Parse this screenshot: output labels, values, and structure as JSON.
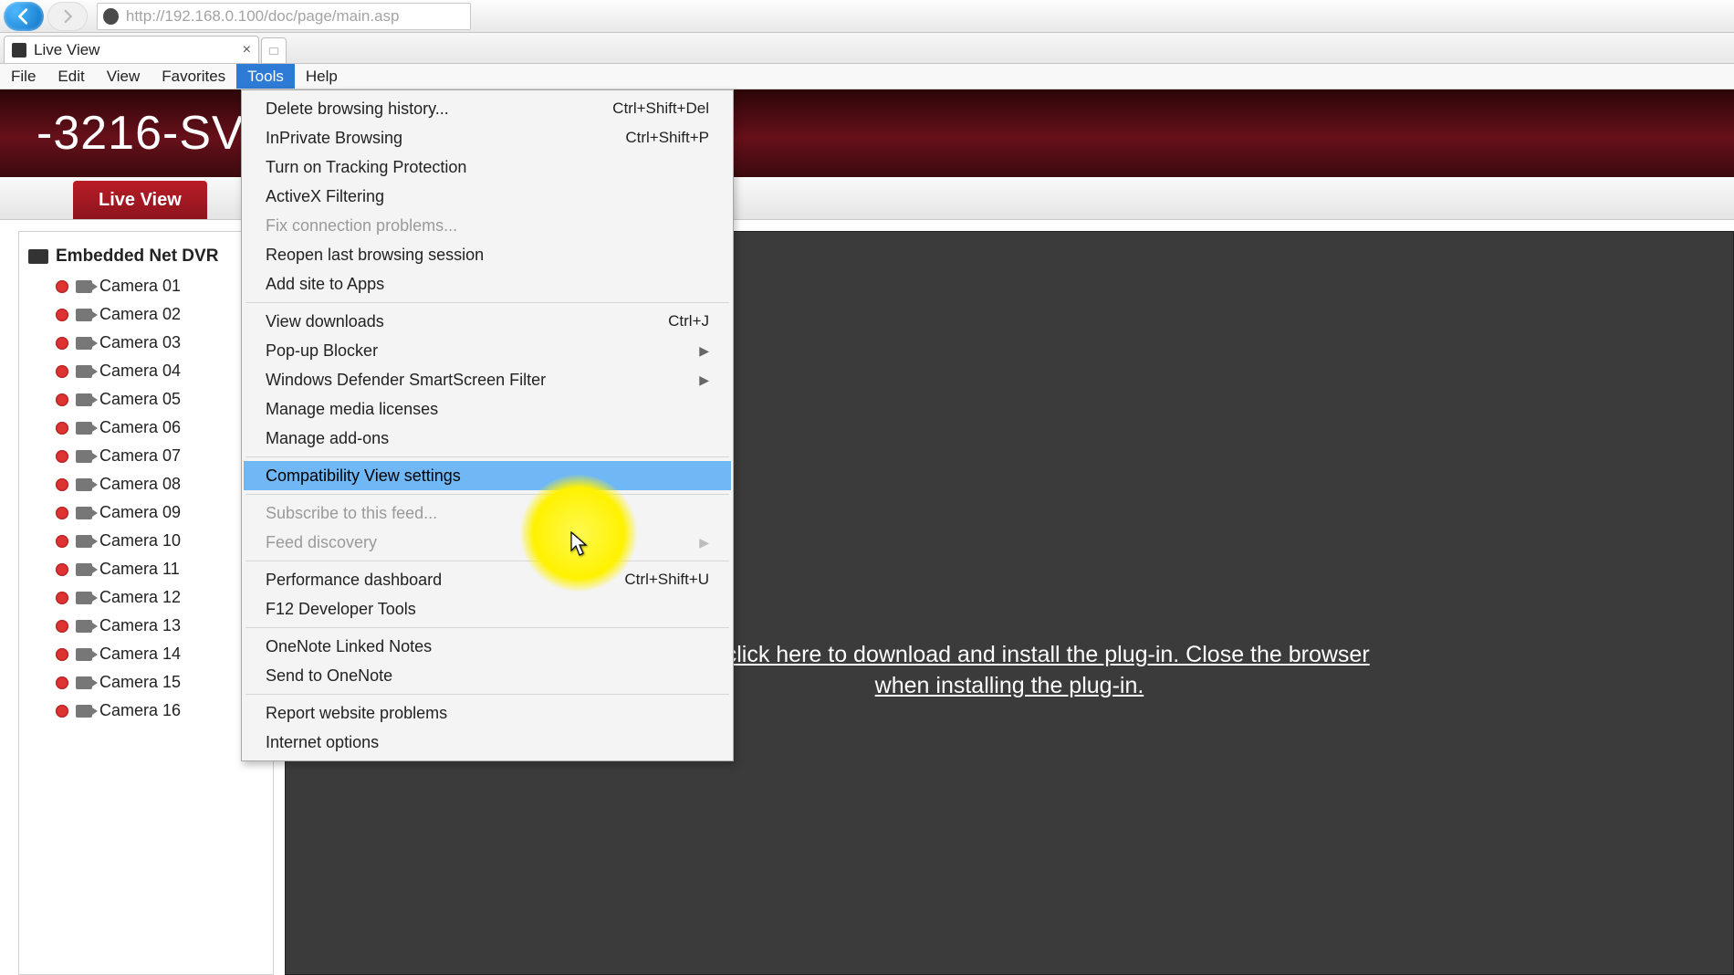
{
  "browser": {
    "address_placeholder": "http://192.168.0.100/doc/page/main.asp",
    "tab_title": "Live View"
  },
  "menubar": {
    "file": "File",
    "edit": "Edit",
    "view": "View",
    "favorites": "Favorites",
    "tools": "Tools",
    "help": "Help"
  },
  "tools_menu": {
    "delete_history": "Delete browsing history...",
    "delete_history_sc": "Ctrl+Shift+Del",
    "inprivate": "InPrivate Browsing",
    "inprivate_sc": "Ctrl+Shift+P",
    "tracking": "Turn on Tracking Protection",
    "activex": "ActiveX Filtering",
    "fix_conn": "Fix connection problems...",
    "reopen": "Reopen last browsing session",
    "add_apps": "Add site to Apps",
    "view_dl": "View downloads",
    "view_dl_sc": "Ctrl+J",
    "popup": "Pop-up Blocker",
    "defender": "Windows Defender SmartScreen Filter",
    "media_lic": "Manage media licenses",
    "addons": "Manage add-ons",
    "compat": "Compatibility View settings",
    "subscribe": "Subscribe to this feed...",
    "feed_disc": "Feed discovery",
    "perf": "Performance dashboard",
    "perf_sc": "Ctrl+Shift+U",
    "f12": "F12 Developer Tools",
    "onenote_linked": "OneNote Linked Notes",
    "onenote_send": "Send to OneNote",
    "report": "Report website problems",
    "inet_opts": "Internet options"
  },
  "page": {
    "model": "-3216-SV",
    "nav_liveview": "Live View"
  },
  "tree": {
    "root": "Embedded Net DVR",
    "cams": [
      "Camera 01",
      "Camera 02",
      "Camera 03",
      "Camera 04",
      "Camera 05",
      "Camera 06",
      "Camera 07",
      "Camera 08",
      "Camera 09",
      "Camera 10",
      "Camera 11",
      "Camera 12",
      "Camera 13",
      "Camera 14",
      "Camera 15",
      "Camera 16"
    ]
  },
  "plugin": {
    "msg": "Please click here to download and install the plug-in. Close the browser when installing the plug-in."
  }
}
